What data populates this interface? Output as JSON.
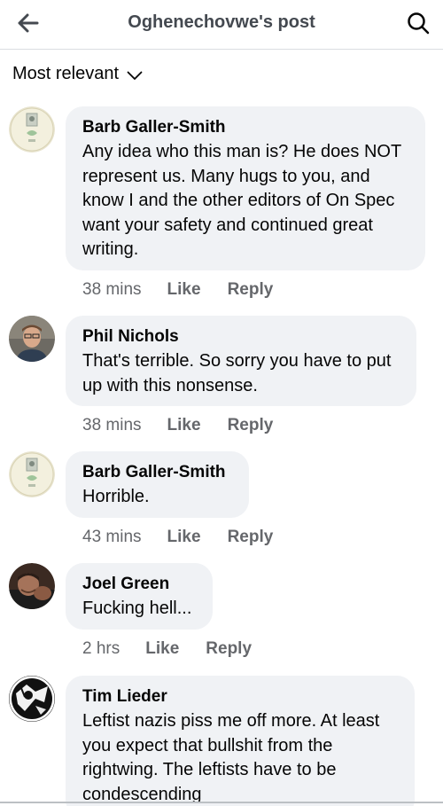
{
  "header": {
    "title": "Oghenechovwe's post",
    "back_icon": "arrow-left-icon",
    "search_icon": "search-icon"
  },
  "sort": {
    "label": "Most relevant",
    "icon": "chevron-down-icon"
  },
  "actions": {
    "like": "Like",
    "reply": "Reply"
  },
  "comments": [
    {
      "author": "Barb Galler-Smith",
      "text": "Any idea who this man is? He does NOT represent us.  Many hugs to you, and know I and the other editors of On Spec want your safety and continued great writing.",
      "time": "38 mins"
    },
    {
      "author": "Phil Nichols",
      "text": "That's terrible. So sorry you have to put up with this nonsense.",
      "time": "38 mins"
    },
    {
      "author": "Barb Galler-Smith",
      "text": "Horrible.",
      "time": "43 mins"
    },
    {
      "author": "Joel Green",
      "text": "Fucking hell...",
      "time": "2 hrs"
    },
    {
      "author": "Tim Lieder",
      "text": "Leftist nazis piss me off more. At least you expect that bullshit from the rightwing. The leftists have to be condescending"
    }
  ],
  "colors": {
    "bubble": "#f0f2f5",
    "meta_text": "#65676b",
    "header_text": "#444950"
  }
}
